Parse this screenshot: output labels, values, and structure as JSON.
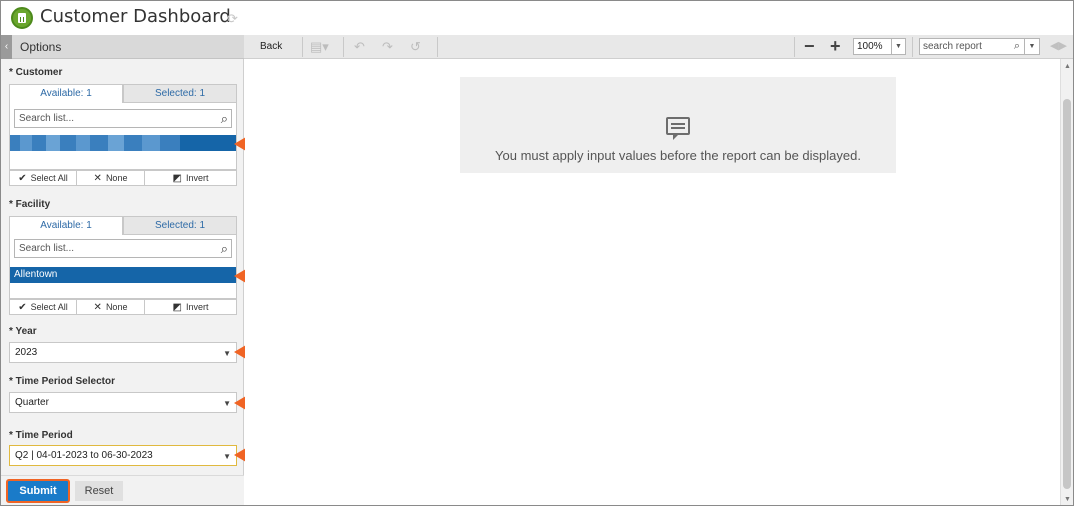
{
  "app": {
    "title": "Customer Dashboard"
  },
  "options": {
    "title": "Options"
  },
  "toolbar": {
    "back_label": "Back",
    "zoom": "100%",
    "search_placeholder": "search report"
  },
  "customer": {
    "label": "* Customer",
    "available_tab": "Available: 1",
    "selected_tab": "Selected: 1",
    "search_placeholder": "Search list...",
    "selected_item": ""
  },
  "facility": {
    "label": "* Facility",
    "available_tab": "Available: 1",
    "selected_tab": "Selected: 1",
    "search_placeholder": "Search list...",
    "selected_item": "Allentown"
  },
  "list_actions": {
    "select_all": "Select All",
    "none": "None",
    "invert": "Invert"
  },
  "year": {
    "label": "* Year",
    "value": "2023"
  },
  "time_period_selector": {
    "label": "* Time Period Selector",
    "value": "Quarter"
  },
  "time_period": {
    "label": "* Time Period",
    "value": "Q2 | 04-01-2023 to 06-30-2023"
  },
  "buttons": {
    "submit": "Submit",
    "reset": "Reset"
  },
  "report": {
    "message": "You must apply input values before the report can be displayed."
  },
  "colors": {
    "accent": "#1565a8",
    "arrow": "#f06424",
    "submit": "#1a7bc9",
    "logo": "#6aa62d"
  }
}
